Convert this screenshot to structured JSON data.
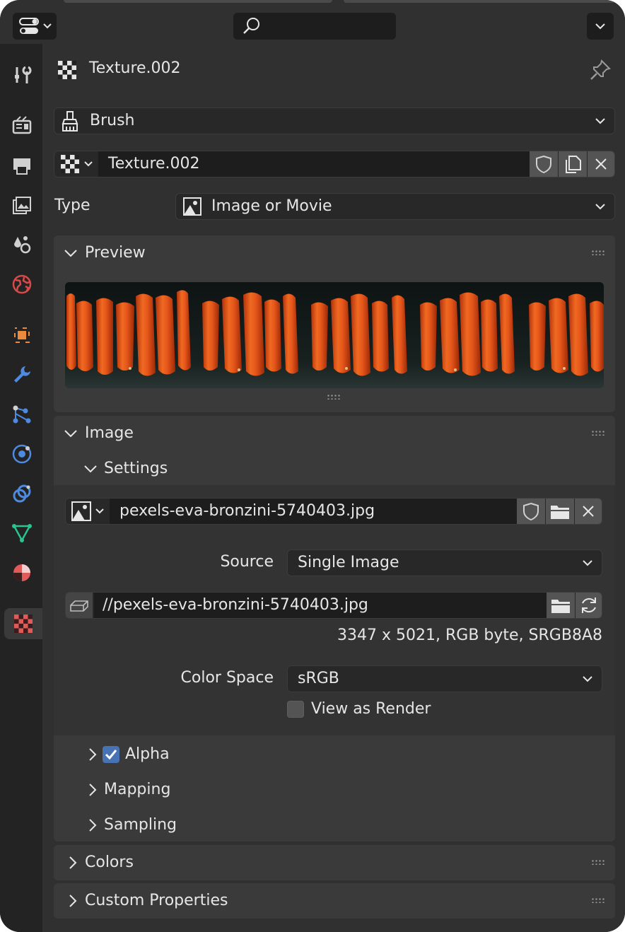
{
  "header": {
    "search_placeholder": ""
  },
  "tabs": [
    {
      "name": "tool-tab",
      "icon": "tool-icon",
      "color": "#d0d0d0"
    },
    {
      "name": "render-tab",
      "icon": "render-icon",
      "color": "#d0d0d0"
    },
    {
      "name": "output-tab",
      "icon": "printer-icon",
      "color": "#d0d0d0"
    },
    {
      "name": "view-layer-tab",
      "icon": "view-layer-icon",
      "color": "#d0d0d0"
    },
    {
      "name": "scene-tab",
      "icon": "scene-icon",
      "color": "#d0d0d0"
    },
    {
      "name": "world-tab",
      "icon": "world-icon",
      "color": "#d84a4a"
    },
    {
      "name": "object-tab",
      "icon": "object-icon",
      "color": "#e98a3c"
    },
    {
      "name": "modifiers-tab",
      "icon": "wrench-icon",
      "color": "#4d8ae0"
    },
    {
      "name": "particles-tab",
      "icon": "particles-icon",
      "color": "#4d8ae0"
    },
    {
      "name": "physics-tab",
      "icon": "physics-icon",
      "color": "#4d8ae0"
    },
    {
      "name": "constraints-tab",
      "icon": "constraints-icon",
      "color": "#4d8ae0"
    },
    {
      "name": "data-tab",
      "icon": "mesh-data-icon",
      "color": "#28c492"
    },
    {
      "name": "material-tab",
      "icon": "material-icon",
      "color": "#e05a5a"
    },
    {
      "name": "texture-tab",
      "icon": "texture-icon",
      "color": "#e05a5a"
    }
  ],
  "context": {
    "title": "Texture.002"
  },
  "brush_selector": {
    "label": "Brush"
  },
  "texture_block": {
    "name": "Texture.002"
  },
  "type_row": {
    "label": "Type",
    "value": "Image or Movie"
  },
  "preview_panel": {
    "title": "Preview"
  },
  "image_panel": {
    "title": "Image",
    "settings_title": "Settings",
    "image_name": "pexels-eva-bronzini-5740403.jpg",
    "source_label": "Source",
    "source_value": "Single Image",
    "filepath": "//pexels-eva-bronzini-5740403.jpg",
    "info": "3347 x 5021,  RGB byte,  SRGB8A8",
    "color_space_label": "Color Space",
    "color_space_value": "sRGB",
    "view_as_render_label": "View as Render",
    "view_as_render_checked": false,
    "alpha_label": "Alpha",
    "alpha_checked": true,
    "mapping_label": "Mapping",
    "sampling_label": "Sampling"
  },
  "colors_panel": {
    "title": "Colors"
  },
  "custom_properties_panel": {
    "title": "Custom Properties"
  }
}
